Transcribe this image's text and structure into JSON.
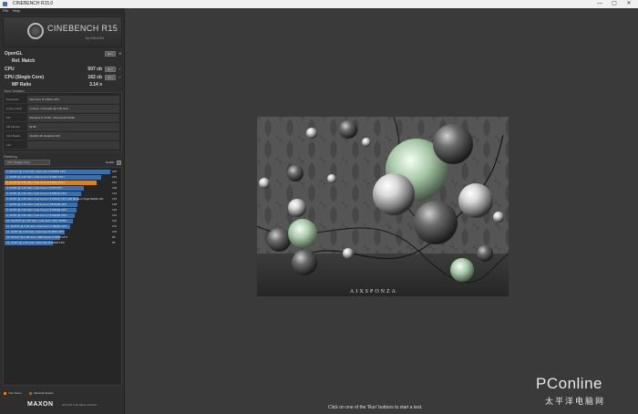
{
  "window": {
    "title": "CINEBENCH R15.0",
    "controls": [
      "—",
      "▢",
      "✕"
    ]
  },
  "menu": {
    "file": "File",
    "help": "Help"
  },
  "logo": {
    "name": "CINEBENCH R15",
    "sub": "by MAXON"
  },
  "benchmarks": [
    {
      "label": "OpenGL",
      "value": "",
      "run": "Run",
      "mark": "✕"
    },
    {
      "label": "Ref. Match",
      "value": "",
      "run": "",
      "mark": ""
    },
    {
      "label": "CPU",
      "value": "507 cb",
      "run": "Run",
      "mark": "✓"
    },
    {
      "label": "CPU (Single Core)",
      "value": "162 cb",
      "run": "Run",
      "mark": "✓"
    },
    {
      "label": "MP Ratio",
      "value": "3.14 x",
      "run": "",
      "mark": ""
    }
  ],
  "system": {
    "heading": "Your System",
    "rows": [
      {
        "key": "Processor",
        "value": "Intel Core i5-7200U CPU"
      },
      {
        "key": "Cores x GHz",
        "value": "4 Cores, 4 Threads @ 2.50 GHz"
      },
      {
        "key": "OS",
        "value": "Windows 8, 64 Bit, China (build 9200)"
      },
      {
        "key": "CB Version",
        "value": "64 Bit"
      },
      {
        "key": "GFX Board",
        "value": "Intel(R) HD Graphics 620"
      },
      {
        "key": "Info",
        "value": ""
      }
    ]
  },
  "ranking": {
    "heading": "Ranking",
    "select": "CPU (Single Core)",
    "details": "Details",
    "rows": [
      {
        "label": "1. 6C/12T @ 3.70 GHz, Intel Core i7-8700K CPU",
        "score": "185",
        "fill": 1.0,
        "current": false
      },
      {
        "label": "2. 4C/8T @ 4.00 GHz, Intel Core i7-6700K CPU",
        "score": "169",
        "fill": 0.91,
        "current": false
      },
      {
        "label": "3. 4C/4T @ 2.50 GHz, Intel Core i5-7200U CPU",
        "score": "162",
        "fill": 0.87,
        "current": true
      },
      {
        "label": "4. 4C/8T @ 3.40 GHz, Intel Core i7-3770 CPU",
        "score": "138",
        "fill": 0.75,
        "current": false
      },
      {
        "label": "5. 4C/8T @ 2.60 GHz, Intel Core i7-6700HQ CPU",
        "score": "133",
        "fill": 0.72,
        "current": false
      },
      {
        "label": "6. 4C/8T @ 2.50 GHz, Intel Core i7-4710HQ CPU with Radeon Vega Mobile Gfx",
        "score": "130",
        "fill": 0.7,
        "current": false
      },
      {
        "label": "7. 4C/8T @ 2.30 GHz, Intel Core i7-3615QM CPU",
        "score": "128",
        "fill": 0.69,
        "current": false
      },
      {
        "label": "8. 4C/8T @ 2.40 GHz, Intel Core i7-4700MQ CPU",
        "score": "125",
        "fill": 0.68,
        "current": false
      },
      {
        "label": "9. 4C/8T @ 2.60 GHz, Intel Core i7-3720QM CPU",
        "score": "122",
        "fill": 0.66,
        "current": false
      },
      {
        "label": "10. 12C/24T @ 2.66 GHz, Intel Xeon CPU X5650",
        "score": "120",
        "fill": 0.65,
        "current": false
      },
      {
        "label": "11. 6C/12T @ 3.30 GHz, Intel Core i7-3930K CPU",
        "score": "115",
        "fill": 0.62,
        "current": false
      },
      {
        "label": "12. 4C/4T @ 3.40 GHz, Intel Core i5-3570 CPU",
        "score": "105",
        "fill": 0.57,
        "current": false
      },
      {
        "label": "13. 6C/12T @ 2.80 GHz, AMD Ryzen 5 1600 CPU",
        "score": "98",
        "fill": 0.53,
        "current": false
      },
      {
        "label": "14. 2C/4T @ 2.40 GHz, Intel Core i5-520M CPU",
        "score": "85",
        "fill": 0.46,
        "current": false
      }
    ]
  },
  "legend": {
    "your_score": "Your Score",
    "identical": "Identical System",
    "your_color": "#d5822b",
    "identical_color": "#9c6a3a"
  },
  "footer": {
    "brand": "MAXON",
    "tagline": "3D FOR THE REAL WORLD"
  },
  "status": "Click on one of the 'Run' buttons to start a test.",
  "render": {
    "watermark": "AIXSPONZA"
  },
  "watermark": {
    "brand": "PConline",
    "sub": "太平洋电脑网"
  },
  "colors": {
    "bar": "#3f6fa8",
    "current_bar": "#d5822b",
    "background": "#3a3a3a"
  }
}
